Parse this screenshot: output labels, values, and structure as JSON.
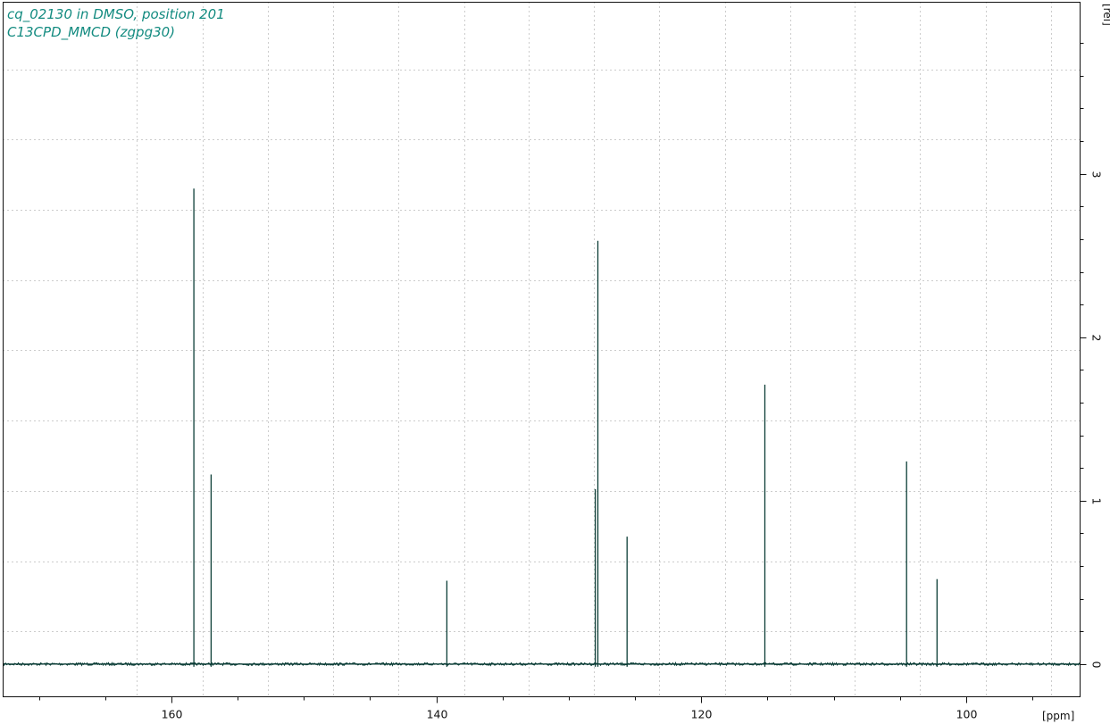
{
  "chart_data": {
    "type": "line",
    "title_lines": [
      "cq_02130 in DMSO, position 201",
      "C13CPD_MMCD (zgpg30)"
    ],
    "xlabel": "[ppm]",
    "ylabel": "[rel]",
    "xlim": [
      172.7,
      91.4
    ],
    "ylim": [
      -0.2,
      4.05
    ],
    "x_reversed": true,
    "x_ticks": [
      160,
      140,
      120,
      100
    ],
    "x_minor_ticks": [
      170,
      165,
      155,
      150,
      145,
      135,
      130,
      125,
      115,
      110,
      105,
      95
    ],
    "y_ticks": [
      0,
      1,
      2,
      3
    ],
    "y_minor_ticks": [
      0.2,
      0.4,
      0.6,
      0.8,
      1.2,
      1.4,
      1.6,
      1.8,
      2.2,
      2.4,
      2.6,
      2.8,
      3.2,
      3.4,
      3.6,
      3.8
    ],
    "x_gridlines": [
      162.6,
      157.6,
      152.7,
      147.8,
      142.9,
      137.9,
      133.0,
      128.1,
      123.2,
      118.2,
      113.3,
      108.4,
      103.5,
      98.5,
      93.6
    ],
    "y_gridlines": [
      0.2,
      0.63,
      1.06,
      1.49,
      1.92,
      2.35,
      2.78,
      3.21,
      3.64
    ],
    "grid": true,
    "line_color": "#0b3d36",
    "title_color": "#138b80",
    "series": [
      {
        "peaks": [
          {
            "ppm": 158.3,
            "height": 2.91
          },
          {
            "ppm": 157.0,
            "height": 1.16
          },
          {
            "ppm": 139.2,
            "height": 0.51
          },
          {
            "ppm": 128.0,
            "height": 1.07
          },
          {
            "ppm": 127.8,
            "height": 2.59
          },
          {
            "ppm": 125.6,
            "height": 0.78
          },
          {
            "ppm": 115.2,
            "height": 1.71
          },
          {
            "ppm": 104.5,
            "height": 1.24
          },
          {
            "ppm": 102.2,
            "height": 0.52
          }
        ]
      }
    ]
  }
}
